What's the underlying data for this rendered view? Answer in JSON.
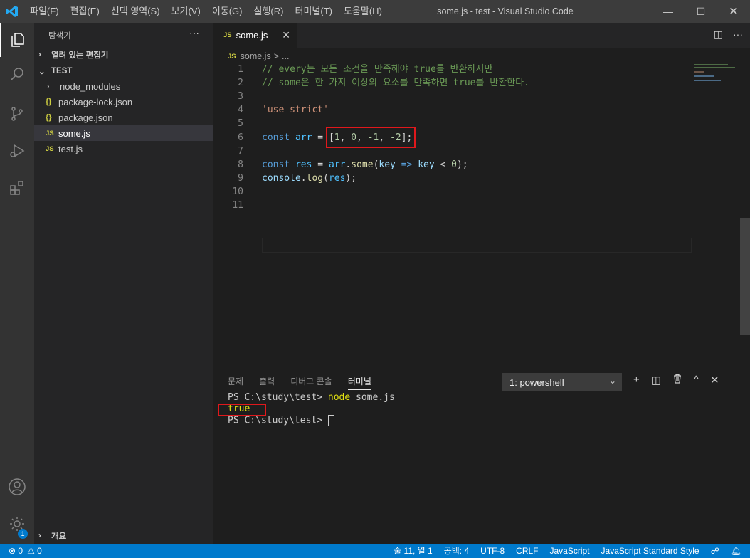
{
  "titlebar": {
    "menu": [
      "파일(F)",
      "편집(E)",
      "선택 영역(S)",
      "보기(V)",
      "이동(G)",
      "실행(R)",
      "터미널(T)",
      "도움말(H)"
    ],
    "window_title": "some.js - test - Visual Studio Code",
    "minimize": "—",
    "maximize": "☐",
    "close": "✕"
  },
  "activity_bar": {
    "items": [
      "explorer-icon",
      "search-icon",
      "source-control-icon",
      "run-debug-icon",
      "extensions-icon"
    ],
    "bottom": [
      "account-icon",
      "settings-gear-icon"
    ],
    "settings_badge": "1"
  },
  "sidebar": {
    "title": "탐색기",
    "more": "···",
    "open_editors_label": "열려 있는 편집기",
    "folder_label": "TEST",
    "files": [
      {
        "name": "node_modules",
        "icon": "chevron-right-icon",
        "glyph": "›"
      },
      {
        "name": "package-lock.json",
        "icon": "json-icon",
        "glyph": "{}"
      },
      {
        "name": "package.json",
        "icon": "json-icon",
        "glyph": "{}"
      },
      {
        "name": "some.js",
        "icon": "js-icon",
        "glyph": "JS"
      },
      {
        "name": "test.js",
        "icon": "js-icon",
        "glyph": "JS"
      }
    ],
    "outline_label": "개요"
  },
  "editor": {
    "tab_label": "some.js",
    "tab_icon": "JS",
    "close": "✕",
    "breadcrumb": {
      "icon": "JS",
      "file": "some.js",
      "sep": ">",
      "rest": "..."
    },
    "line_numbers": [
      "1",
      "2",
      "3",
      "4",
      "5",
      "6",
      "7",
      "8",
      "9",
      "10",
      "11"
    ],
    "lines": {
      "l1": "// every는 모든 조건을 만족해야 true를 반환하지만",
      "l2": "// some은 한 가지 이상의 요소를 만족하면 true를 반환한다.",
      "l4": "'use strict'",
      "l6_kw": "const",
      "l6_var": "arr",
      "l6_eq": " = ",
      "l6_open": "[",
      "l6_n1": "1",
      "l6_c1": ", ",
      "l6_n2": "0",
      "l6_c2": ", ",
      "l6_n3": "-1",
      "l6_c3": ", ",
      "l6_n4": "-2",
      "l6_close": "];",
      "l8_kw": "const",
      "l8_var": "res",
      "l8_eq": " = ",
      "l8_obj": "arr",
      "l8_dot": ".",
      "l8_fn": "some",
      "l8_p1": "(",
      "l8_key": "key",
      "l8_arrow": " => ",
      "l8_key2": "key",
      "l8_lt": " < ",
      "l8_zero": "0",
      "l8_end": ");",
      "l9_obj": "console",
      "l9_dot": ".",
      "l9_fn": "log",
      "l9_p1": "(",
      "l9_arg": "res",
      "l9_end": ");"
    }
  },
  "panel": {
    "tabs": [
      "문제",
      "출력",
      "디버그 콘솔",
      "터미널"
    ],
    "active_tab": "터미널",
    "terminal_select": "1: powershell",
    "actions": [
      "+",
      "◫",
      "🗑",
      "^",
      "✕"
    ],
    "terminal_lines": {
      "t1_prompt": "PS C:\\study\\test> ",
      "t1_cmd": "node",
      "t1_arg": " some.js",
      "t2": "true",
      "t3_prompt": "PS C:\\study\\test> "
    }
  },
  "statusbar": {
    "errors": "⊗ 0",
    "warnings": "⚠ 0",
    "position": "줄 11, 열 1",
    "spaces": "공백: 4",
    "encoding": "UTF-8",
    "eol": "CRLF",
    "language": "JavaScript",
    "style": "JavaScript Standard Style"
  },
  "colors": {
    "accent": "#007acc",
    "highlight_box": "#e0181c"
  }
}
